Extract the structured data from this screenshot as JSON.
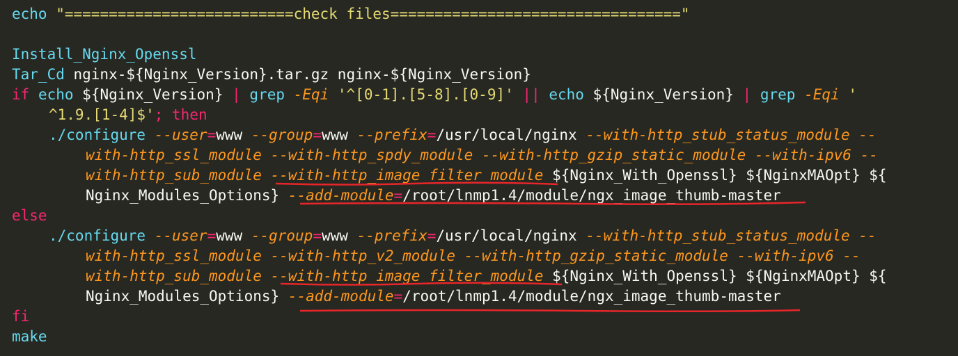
{
  "theme": {
    "background": "#272822",
    "plain": "#f8f8f2",
    "command": "#66d9ef",
    "keyword": "#f92672",
    "string": "#e6db74",
    "option": "#fd971f",
    "annotation": "#e8262a"
  },
  "lines": [
    {
      "tokens": [
        {
          "t": "cmd",
          "v": "echo"
        },
        {
          "t": "plain",
          "v": " "
        },
        {
          "t": "string",
          "v": "\"==========================check files=================================\""
        }
      ]
    },
    {
      "tokens": []
    },
    {
      "tokens": [
        {
          "t": "cmd",
          "v": "Install_Nginx_Openssl"
        }
      ]
    },
    {
      "tokens": [
        {
          "t": "cmd",
          "v": "Tar_Cd"
        },
        {
          "t": "plain",
          "v": " nginx-${Nginx_Version}.tar.gz nginx-${Nginx_Version}"
        }
      ]
    },
    {
      "tokens": [
        {
          "t": "keyword",
          "v": "if"
        },
        {
          "t": "plain",
          "v": " "
        },
        {
          "t": "cmd",
          "v": "echo"
        },
        {
          "t": "plain",
          "v": " ${Nginx_Version} "
        },
        {
          "t": "op",
          "v": "|"
        },
        {
          "t": "plain",
          "v": " "
        },
        {
          "t": "cmd",
          "v": "grep"
        },
        {
          "t": "plain",
          "v": " "
        },
        {
          "t": "option",
          "v": "-Eqi"
        },
        {
          "t": "plain",
          "v": " "
        },
        {
          "t": "string",
          "v": "'^[0-1].[5-8].[0-9]'"
        },
        {
          "t": "plain",
          "v": " "
        },
        {
          "t": "op",
          "v": "||"
        },
        {
          "t": "plain",
          "v": " "
        },
        {
          "t": "cmd",
          "v": "echo"
        },
        {
          "t": "plain",
          "v": " ${Nginx_Version} "
        },
        {
          "t": "op",
          "v": "|"
        },
        {
          "t": "plain",
          "v": " "
        },
        {
          "t": "cmd",
          "v": "grep"
        },
        {
          "t": "plain",
          "v": " "
        },
        {
          "t": "option",
          "v": "-Eqi"
        },
        {
          "t": "plain",
          "v": " "
        },
        {
          "t": "string",
          "v": "'"
        }
      ]
    },
    {
      "tokens": [
        {
          "t": "string",
          "v": "^1.9.[1-4]$'"
        },
        {
          "t": "keyword",
          "v": ";"
        },
        {
          "t": "plain",
          "v": " "
        },
        {
          "t": "keyword",
          "v": "then"
        }
      ]
    },
    {
      "tokens": [
        {
          "t": "cmd",
          "v": "./configure"
        },
        {
          "t": "plain",
          "v": " "
        },
        {
          "t": "option",
          "v": "--user"
        },
        {
          "t": "op",
          "v": "="
        },
        {
          "t": "plain",
          "v": "www "
        },
        {
          "t": "option",
          "v": "--group"
        },
        {
          "t": "op",
          "v": "="
        },
        {
          "t": "plain",
          "v": "www "
        },
        {
          "t": "option",
          "v": "--prefix"
        },
        {
          "t": "op",
          "v": "="
        },
        {
          "t": "plain",
          "v": "/usr/local/nginx "
        },
        {
          "t": "option",
          "v": "--with-http_stub_status_module --"
        }
      ]
    },
    {
      "tokens": [
        {
          "t": "option",
          "v": "with-http_ssl_module --with-http_spdy_module --with-http_gzip_static_module --with-ipv6 --"
        }
      ]
    },
    {
      "tokens": [
        {
          "t": "option",
          "v": "with-http_sub_module --with-http_image_filter_module"
        },
        {
          "t": "plain",
          "v": " ${Nginx_With_Openssl} ${NginxMAOpt} ${"
        }
      ]
    },
    {
      "tokens": [
        {
          "t": "plain",
          "v": "Nginx_Modules_Options} "
        },
        {
          "t": "option",
          "v": "--add-module"
        },
        {
          "t": "op",
          "v": "="
        },
        {
          "t": "plain",
          "v": "/root/lnmp1.4/module/ngx_image_thumb-master"
        }
      ]
    },
    {
      "tokens": [
        {
          "t": "keyword",
          "v": "else"
        }
      ]
    },
    {
      "tokens": [
        {
          "t": "cmd",
          "v": "./configure"
        },
        {
          "t": "plain",
          "v": " "
        },
        {
          "t": "option",
          "v": "--user"
        },
        {
          "t": "op",
          "v": "="
        },
        {
          "t": "plain",
          "v": "www "
        },
        {
          "t": "option",
          "v": "--group"
        },
        {
          "t": "op",
          "v": "="
        },
        {
          "t": "plain",
          "v": "www "
        },
        {
          "t": "option",
          "v": "--prefix"
        },
        {
          "t": "op",
          "v": "="
        },
        {
          "t": "plain",
          "v": "/usr/local/nginx "
        },
        {
          "t": "option",
          "v": "--with-http_stub_status_module --"
        }
      ]
    },
    {
      "tokens": [
        {
          "t": "option",
          "v": "with-http_ssl_module --with-http_v2_module --with-http_gzip_static_module --with-ipv6 --"
        }
      ]
    },
    {
      "tokens": [
        {
          "t": "option",
          "v": "with-http_sub_module --with-http_image_filter_module"
        },
        {
          "t": "plain",
          "v": " ${Nginx_With_Openssl} ${NginxMAOpt} ${"
        }
      ]
    },
    {
      "tokens": [
        {
          "t": "plain",
          "v": "Nginx_Modules_Options} "
        },
        {
          "t": "option",
          "v": "--add-module"
        },
        {
          "t": "op",
          "v": "="
        },
        {
          "t": "plain",
          "v": "/root/lnmp1.4/module/ngx_image_thumb-master"
        }
      ]
    },
    {
      "tokens": [
        {
          "t": "keyword",
          "v": "fi"
        }
      ]
    },
    {
      "tokens": [
        {
          "t": "cmd",
          "v": "make"
        }
      ]
    }
  ]
}
